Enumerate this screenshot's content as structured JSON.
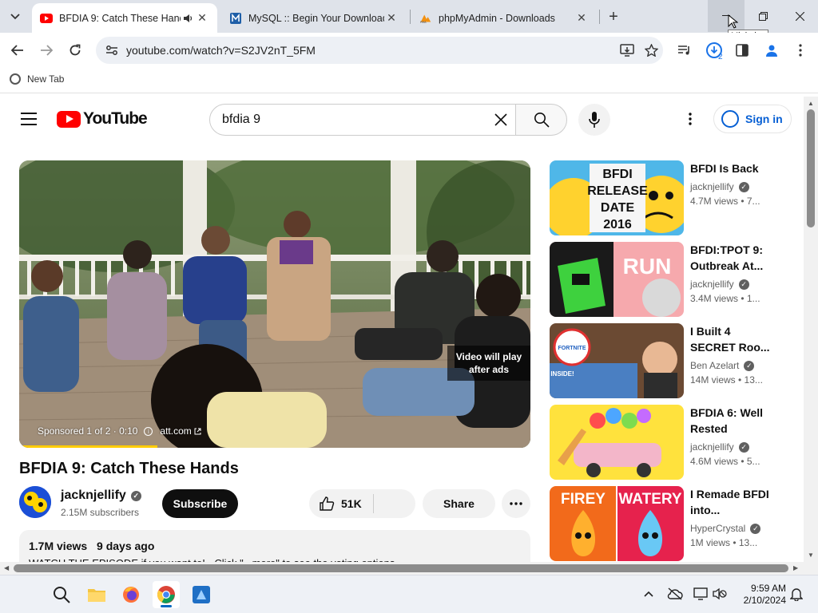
{
  "browser": {
    "tabs": [
      {
        "title": "BFDIA 9: Catch These Hands",
        "favicon": "youtube-icon",
        "audio": true,
        "active": true
      },
      {
        "title": "MySQL :: Begin Your Download",
        "favicon": "mysql-icon",
        "active": false
      },
      {
        "title": "phpMyAdmin - Downloads",
        "favicon": "phpmyadmin-icon",
        "active": false
      }
    ],
    "tooltip": "Minimize",
    "address": "youtube.com/watch?v=S2JV2nT_5FM",
    "download_badge": "2",
    "bookmarks": [
      {
        "label": "New Tab"
      }
    ]
  },
  "youtube": {
    "search_query": "bfdia 9",
    "sign_in": "Sign in",
    "player": {
      "skip_hint_line1": "Video will play",
      "skip_hint_line2": "after ads",
      "ad_label": "Sponsored 1 of 2 · 0:10",
      "advertiser": "att.com",
      "ad_progress_fraction": 0.27
    },
    "video": {
      "title": "BFDIA 9: Catch These Hands",
      "channel": "jacknjellify",
      "subscribers": "2.15M subscribers",
      "subscribe_label": "Subscribe",
      "likes": "51K",
      "share_label": "Share",
      "views": "1.7M views",
      "age": "9 days ago",
      "description": "WATCH THE EPISODE if you want to! · Click \"...more\" to see the voting options."
    },
    "recommendations": [
      {
        "title_line1": "BFDI Is Back",
        "title_line2": "",
        "channel": "jacknjellify",
        "verified": true,
        "meta": "4.7M views  •  7..."
      },
      {
        "title_line1": "BFDI:TPOT 9:",
        "title_line2": "Outbreak At...",
        "channel": "jacknjellify",
        "verified": true,
        "meta": "3.4M views  •  1..."
      },
      {
        "title_line1": "I Built 4",
        "title_line2": "SECRET Roo...",
        "channel": "Ben Azelart",
        "verified": true,
        "meta": "14M views  •  13..."
      },
      {
        "title_line1": "BFDIA 6: Well",
        "title_line2": "Rested",
        "channel": "jacknjellify",
        "verified": true,
        "meta": "4.6M views  •  5..."
      },
      {
        "title_line1": "I Remade BFDI",
        "title_line2": "into...",
        "channel": "HyperCrystal",
        "verified": true,
        "meta": "1M views  •  13..."
      }
    ],
    "thumb_text": {
      "t1": [
        "BFDI",
        "RELEASE",
        "DATE",
        "2016"
      ],
      "t2": "RUN",
      "t3_badge": "FORTNITE",
      "t3_tag": "INSIDE!",
      "t5_left": "FIREY",
      "t5_right": "WATERY"
    }
  },
  "taskbar": {
    "time": "9:59 AM",
    "date": "2/10/2024"
  },
  "colors": {
    "youtube_red": "#ff0000",
    "link_blue": "#065fd4",
    "ad_yellow": "#ffcc00"
  }
}
